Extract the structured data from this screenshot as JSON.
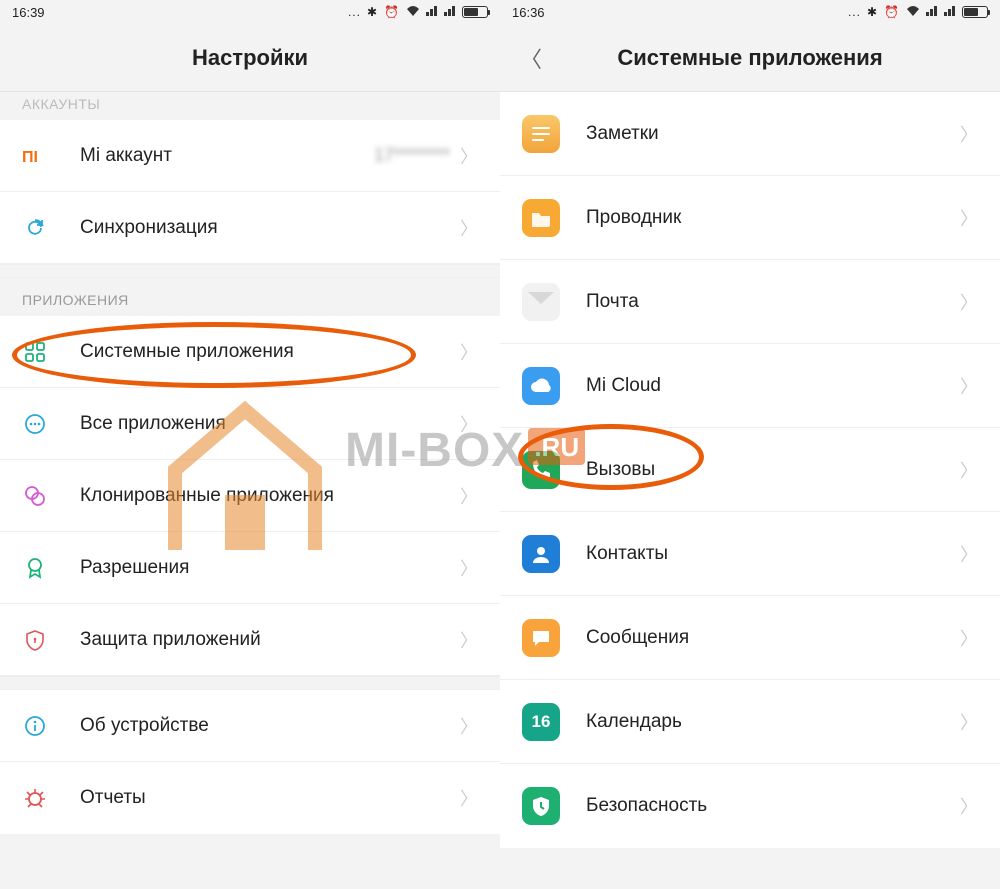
{
  "left": {
    "time": "16:39",
    "title": "Настройки",
    "section_accounts": "АККАУНТЫ",
    "section_apps": "ПРИЛОЖЕНИЯ",
    "rows": {
      "mi_account": {
        "label": "Mi аккаунт",
        "value": "17********"
      },
      "sync": {
        "label": "Синхронизация"
      },
      "system_apps": {
        "label": "Системные приложения"
      },
      "all_apps": {
        "label": "Все приложения"
      },
      "cloned_apps": {
        "label": "Клонированные приложения"
      },
      "permissions": {
        "label": "Разрешения"
      },
      "app_lock": {
        "label": "Защита приложений"
      },
      "about": {
        "label": "Об устройстве"
      },
      "reports": {
        "label": "Отчеты"
      }
    }
  },
  "right": {
    "time": "16:36",
    "title": "Системные приложения",
    "rows": {
      "notes": {
        "label": "Заметки"
      },
      "explorer": {
        "label": "Проводник"
      },
      "mail": {
        "label": "Почта"
      },
      "micloud": {
        "label": "Mi Cloud"
      },
      "calls": {
        "label": "Вызовы"
      },
      "contacts": {
        "label": "Контакты"
      },
      "messages": {
        "label": "Сообщения"
      },
      "calendar": {
        "label": "Календарь",
        "day": "16"
      },
      "security": {
        "label": "Безопасность"
      }
    }
  },
  "status_icons": "...",
  "watermark": {
    "text": "MI-BOX",
    "suffix": ".RU"
  },
  "colors": {
    "highlight": "#e85c0a",
    "notes": "#f7a93b",
    "explorer": "#f5a623",
    "micloud": "#3a9df0",
    "calls": "#1fa85a",
    "contacts": "#1f7ed6",
    "messages": "#f8a33c",
    "calendar": "#17a589",
    "security": "#1db071"
  }
}
